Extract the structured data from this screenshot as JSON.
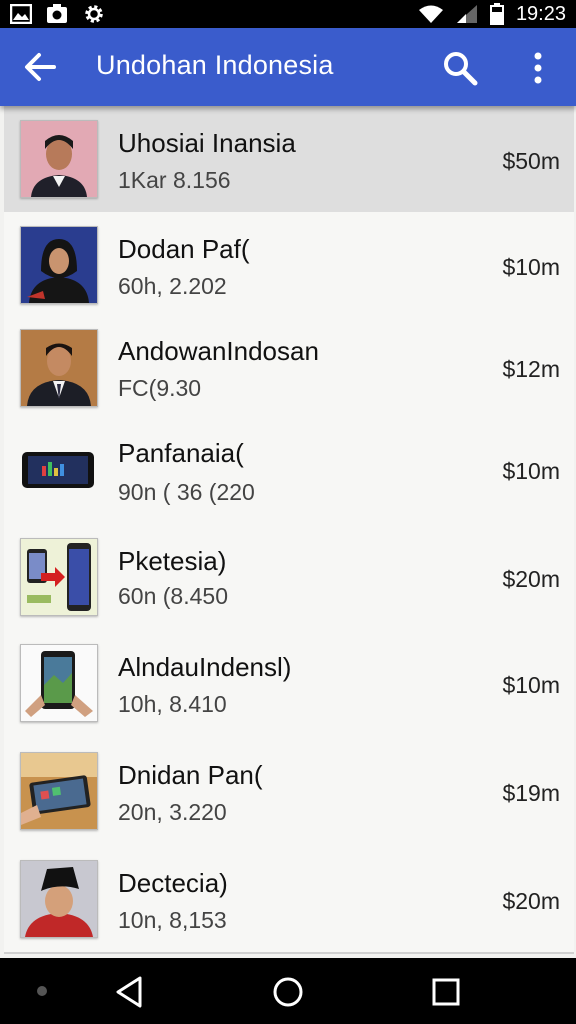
{
  "status_bar": {
    "time": "19:23"
  },
  "app_bar": {
    "title": "Undohan Indonesia"
  },
  "items": [
    {
      "name": "Uhosiai Inansia",
      "sub": "1Kar 8.156",
      "price": "$50m"
    },
    {
      "name": "Dodan Paf(",
      "sub": "60h, 2.202",
      "price": "$10m"
    },
    {
      "name": "AndowanIndosan",
      "sub": "FC(9.30",
      "price": "$12m"
    },
    {
      "name": "Panfanaia(",
      "sub": "90n ( 36 (220",
      "price": "$10m"
    },
    {
      "name": "Pketesia)",
      "sub": "60n (8.450",
      "price": "$20m"
    },
    {
      "name": "AlndauIndensl)",
      "sub": "10h, 8.410",
      "price": "$10m"
    },
    {
      "name": "Dnidan Pan(",
      "sub": "20n, 3.220",
      "price": "$19m"
    },
    {
      "name": "Dectecia)",
      "sub": "10n, 8,153",
      "price": "$20m"
    }
  ],
  "colors": {
    "app_bar": "#3a5ccc",
    "list_bg": "#f7f7f5",
    "selected_row": "#dedede"
  }
}
